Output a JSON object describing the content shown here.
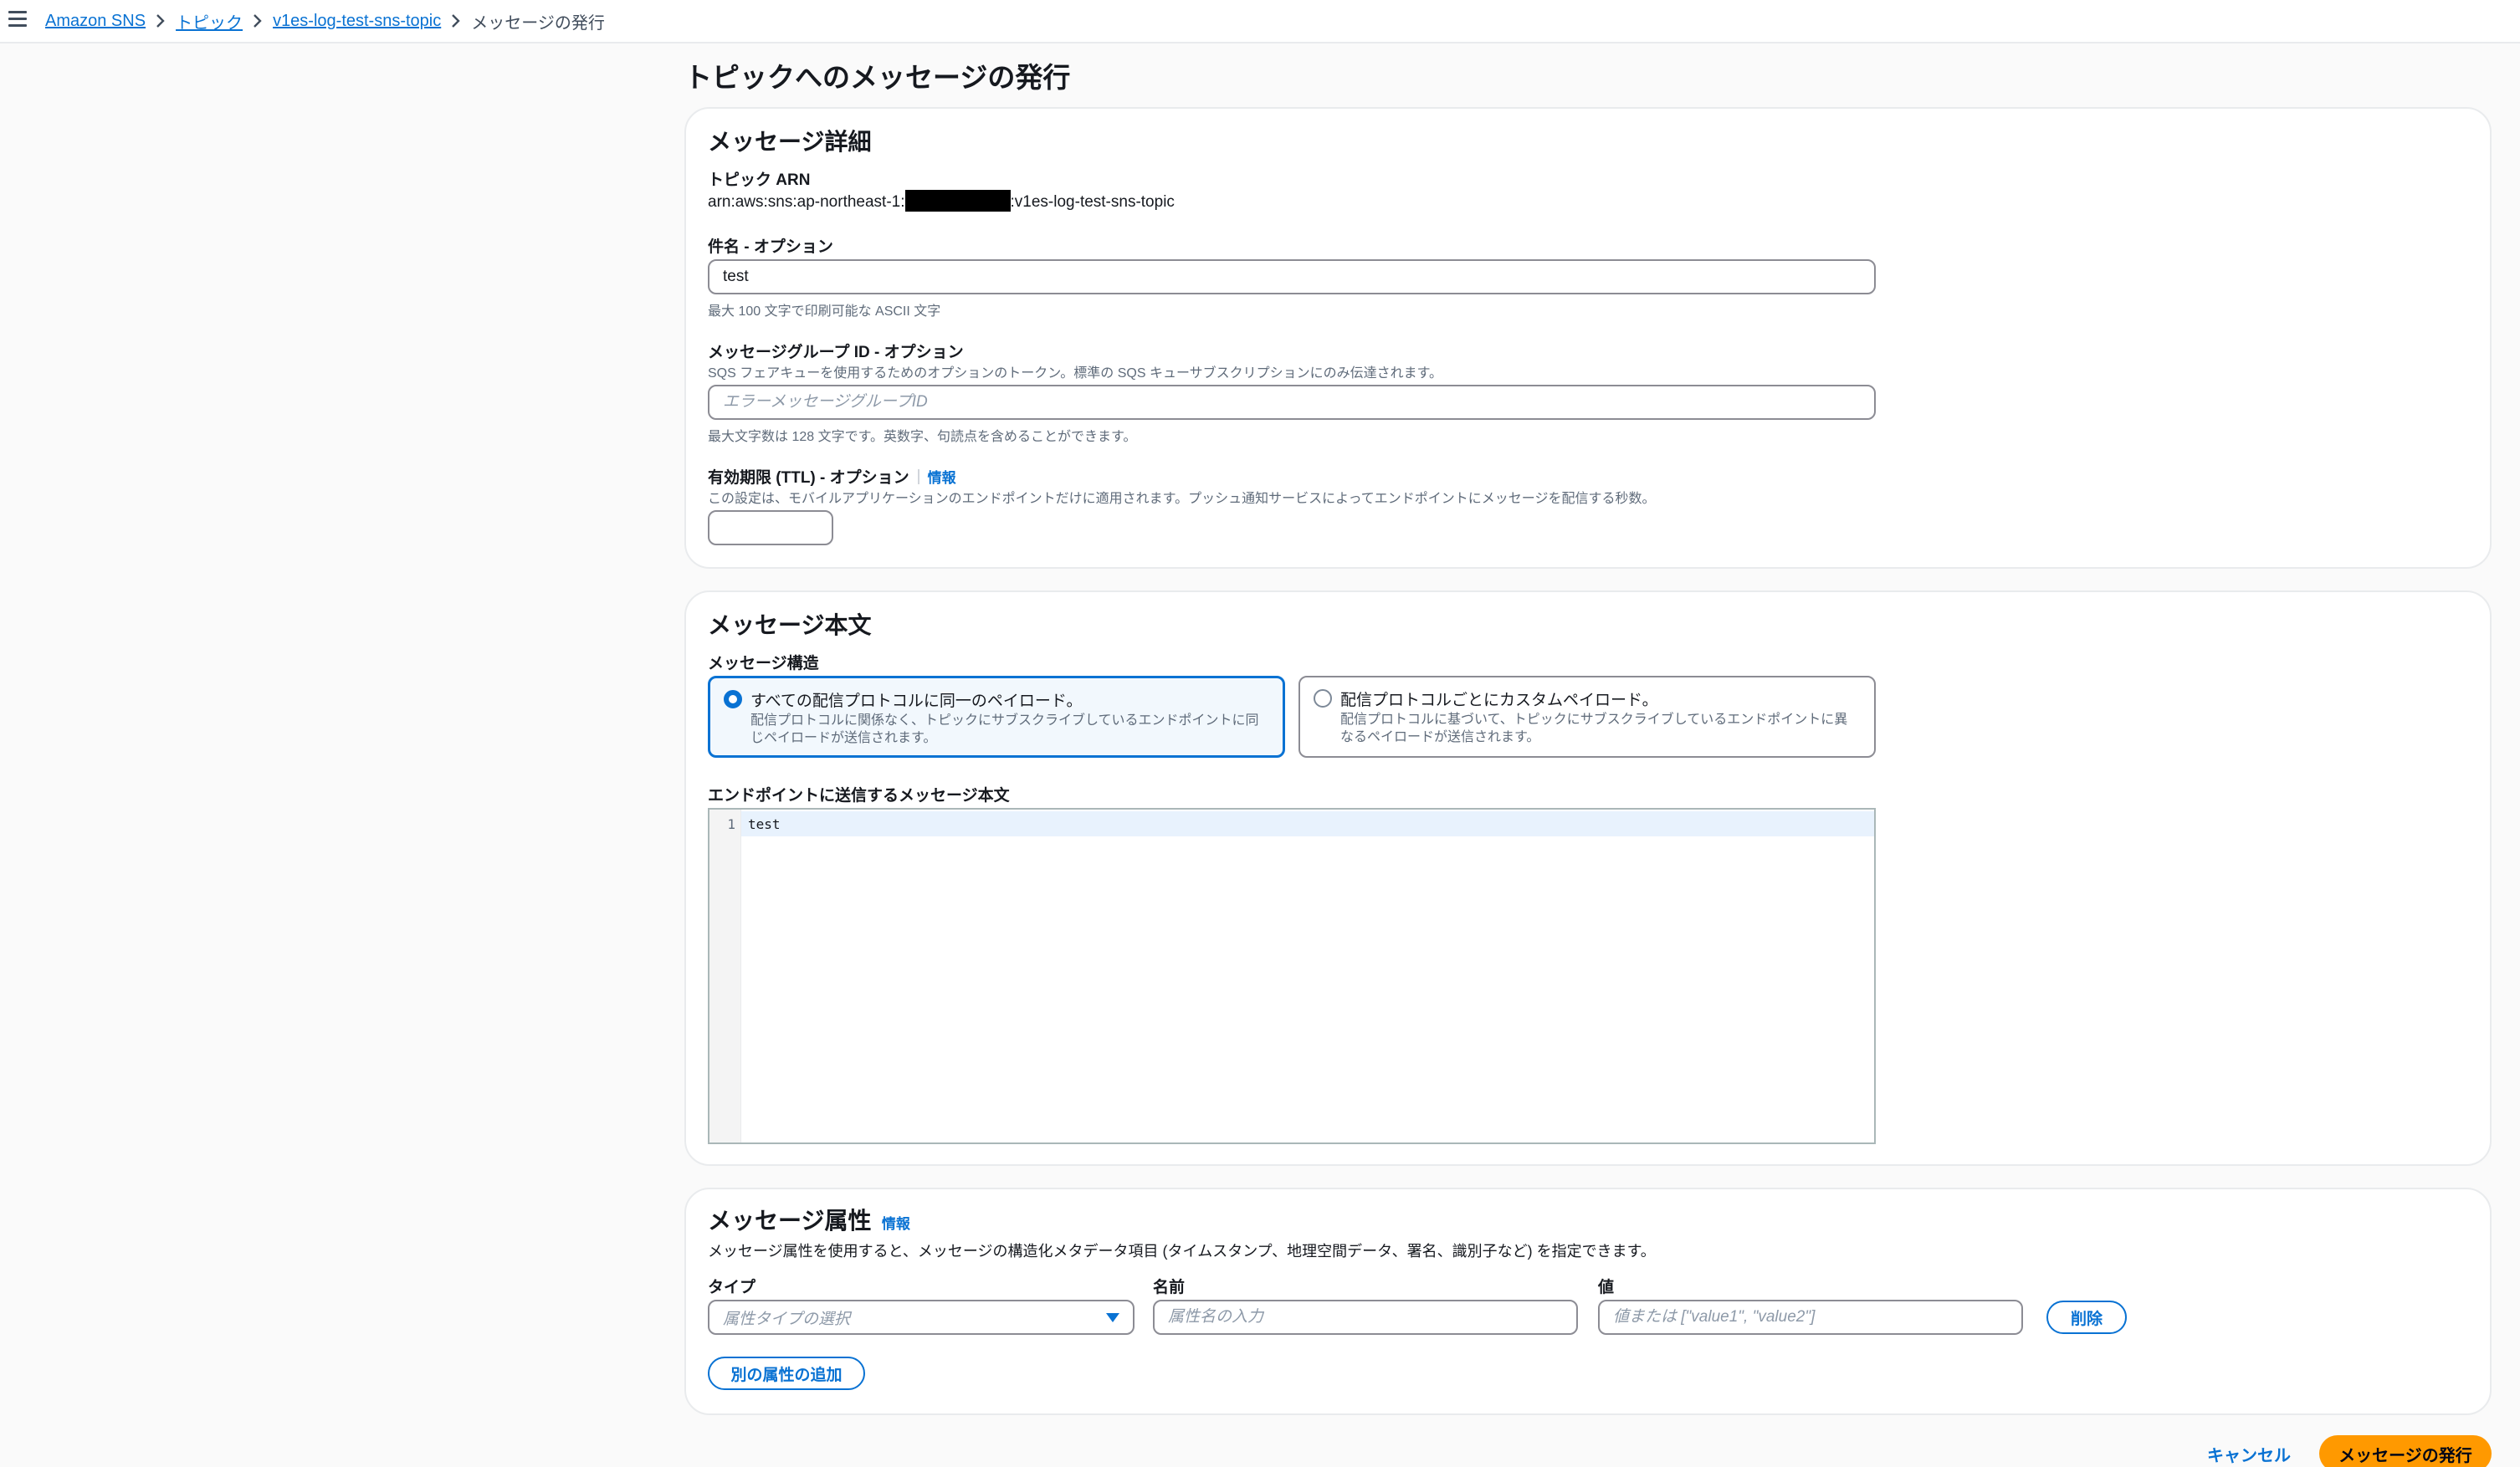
{
  "breadcrumb": {
    "items": [
      "Amazon SNS",
      "トピック",
      "v1es-log-test-sns-topic"
    ],
    "current": "メッセージの発行"
  },
  "page": {
    "title": "トピックへのメッセージの発行"
  },
  "details": {
    "heading": "メッセージ詳細",
    "topic_arn_label": "トピック ARN",
    "topic_arn_prefix": "arn:aws:sns:ap-northeast-1:",
    "topic_arn_suffix": ":v1es-log-test-sns-topic",
    "subject": {
      "label": "件名 - オプション",
      "value": "test",
      "hint": "最大 100 文字で印刷可能な ASCII 文字"
    },
    "group_id": {
      "label": "メッセージグループ ID - オプション",
      "desc": "SQS フェアキューを使用するためのオプションのトークン。標準の SQS キューサブスクリプションにのみ伝達されます。",
      "placeholder": "エラーメッセージグループID",
      "hint": "最大文字数は 128 文字です。英数字、句読点を含めることができます。"
    },
    "ttl": {
      "label": "有効期限 (TTL) - オプション",
      "info": "情報",
      "desc": "この設定は、モバイルアプリケーションのエンドポイントだけに適用されます。プッシュ通知サービスによってエンドポイントにメッセージを配信する秒数。",
      "value": ""
    }
  },
  "body": {
    "heading": "メッセージ本文",
    "structure_label": "メッセージ構造",
    "option_same": {
      "title": "すべての配信プロトコルに同一のペイロード。",
      "desc": "配信プロトコルに関係なく、トピックにサブスクライブしているエンドポイントに同じペイロードが送信されます。"
    },
    "option_custom": {
      "title": "配信プロトコルごとにカスタムペイロード。",
      "desc": "配信プロトコルに基づいて、トピックにサブスクライブしているエンドポイントに異なるペイロードが送信されます。"
    },
    "editor_label": "エンドポイントに送信するメッセージ本文",
    "line_number": "1",
    "code": "test"
  },
  "attributes": {
    "heading": "メッセージ属性",
    "info": "情報",
    "desc": "メッセージ属性を使用すると、メッセージの構造化メタデータ項目 (タイムスタンプ、地理空間データ、署名、識別子など) を指定できます。",
    "type_label": "タイプ",
    "type_placeholder": "属性タイプの選択",
    "name_label": "名前",
    "name_placeholder": "属性名の入力",
    "value_label": "値",
    "value_placeholder": "値または [\"value1\", \"value2\"]",
    "remove_button": "削除",
    "add_button": "別の属性の追加"
  },
  "actions": {
    "cancel": "キャンセル",
    "publish": "メッセージの発行"
  }
}
